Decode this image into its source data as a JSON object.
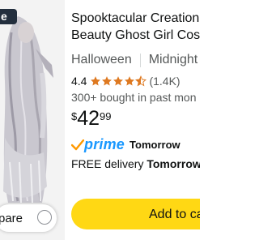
{
  "listing": {
    "badge_text": "e",
    "image_alt": "Beauty Ghost Girl costume product photo",
    "compare_label": "pare",
    "title_line1": "Spooktacular Creation",
    "title_line2": "Beauty Ghost Girl Cos",
    "category": "Halloween",
    "delivery_speed": "Midnight",
    "rating_value": "4.4",
    "rating_stars": 4.4,
    "rating_count": "(1.4K)",
    "bought_text": "300+ bought in past mon",
    "price_symbol": "$",
    "price_whole": "42",
    "price_fraction": "99",
    "prime_label": "prime",
    "prime_day": "Tomorrow",
    "delivery_prefix": "FREE delivery ",
    "delivery_date": "Tomorrow,",
    "add_to_cart_label": "Add to ca"
  },
  "colors": {
    "accent_button": "#ffd814",
    "star": "#de7921",
    "prime_blue": "#1a98ff",
    "muted_text": "#565959"
  },
  "icons": [
    "prime-check-icon",
    "star-icon",
    "compare-checkbox-icon"
  ]
}
